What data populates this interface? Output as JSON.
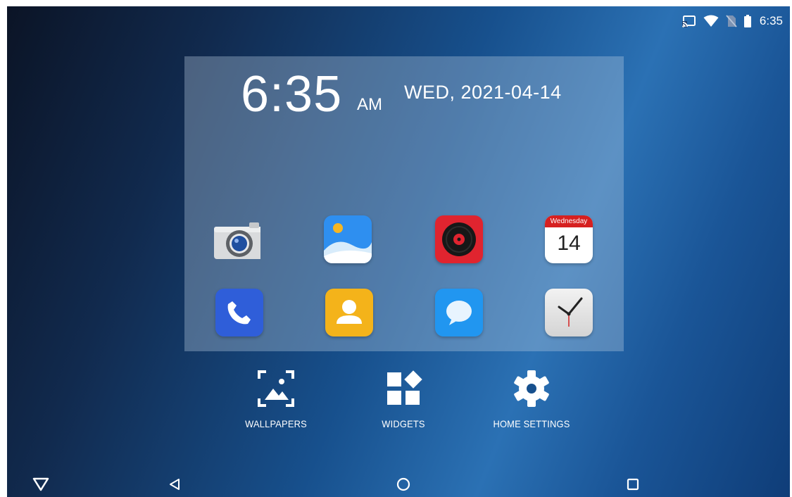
{
  "status_bar": {
    "time": "6:35",
    "icons": [
      "cast-icon",
      "wifi-icon",
      "no-sim-icon",
      "battery-icon"
    ]
  },
  "preview": {
    "clock": {
      "time": "6:35",
      "ampm": "AM",
      "date": "WED, 2021-04-14"
    },
    "apps_row1": [
      {
        "name": "camera-app-icon"
      },
      {
        "name": "gallery-app-icon"
      },
      {
        "name": "music-app-icon"
      },
      {
        "name": "calendar-app-icon",
        "header": "Wednesday",
        "day": "14"
      }
    ],
    "apps_row2": [
      {
        "name": "phone-app-icon"
      },
      {
        "name": "contacts-app-icon"
      },
      {
        "name": "messages-app-icon"
      },
      {
        "name": "clock-app-icon"
      }
    ]
  },
  "actions": {
    "wallpapers": "WALLPAPERS",
    "widgets": "WIDGETS",
    "home_settings": "HOME SETTINGS"
  },
  "nav_bar": {
    "icons": [
      "hide-nav-icon",
      "back-icon",
      "home-icon",
      "recents-icon"
    ]
  },
  "colors": {
    "camera_lens": "#1f4fa0",
    "gallery_bg": "#2e8ff0",
    "music_bg": "#e0242f",
    "calendar_header": "#d62020",
    "phone_bg": "#2f5ed9",
    "contacts_bg": "#f4b31a",
    "messages_bg": "#2196f0"
  }
}
